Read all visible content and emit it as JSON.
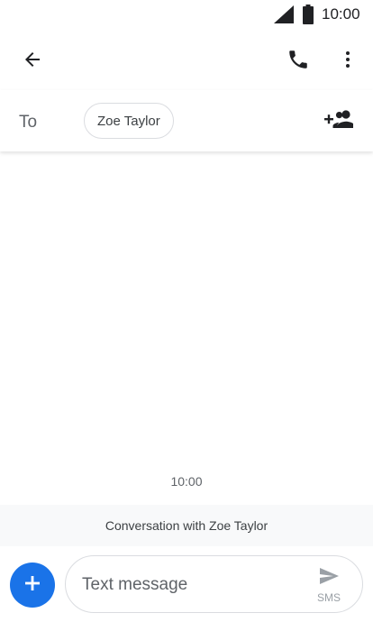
{
  "status_bar": {
    "time": "10:00",
    "icons": [
      "cellular-signal-icon",
      "battery-icon"
    ]
  },
  "app_bar": {
    "icons": [
      "arrow-back-icon",
      "phone-icon",
      "more-vert-icon"
    ]
  },
  "recipient": {
    "to_label": "To",
    "chip_name": "Zoe Taylor",
    "add_icon": "add-people-icon"
  },
  "conversation": {
    "timestamp": "10:00",
    "banner": "Conversation with Zoe Taylor"
  },
  "compose": {
    "placeholder": "Text message",
    "value": "",
    "send_label": "SMS",
    "add_icon": "plus-icon",
    "send_icon": "send-icon"
  },
  "colors": {
    "accent": "#1a73e8",
    "banner_bg": "#f8f9fa",
    "icon": "#202124",
    "send_disabled": "#9aa0a6"
  }
}
